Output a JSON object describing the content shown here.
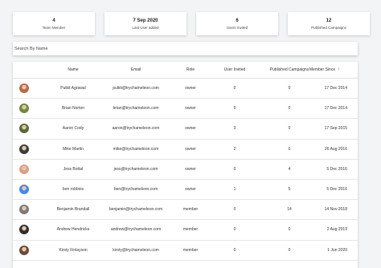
{
  "stats": [
    {
      "value": "4",
      "label": "Team Member"
    },
    {
      "value": "7 Sep 2020",
      "label": "Last User added"
    },
    {
      "value": "6",
      "label": "Users Invited"
    },
    {
      "value": "12",
      "label": "Published Campaigns"
    }
  ],
  "search": {
    "placeholder": "Search By Name"
  },
  "table": {
    "headers": {
      "name": "Name",
      "email": "Email",
      "role": "Role",
      "invited": "User Invited",
      "published": "Published Campaigns",
      "since": "Member Since"
    },
    "sort_icon": "arrow-up",
    "rows": [
      {
        "name": "Pulkit Agrawal",
        "email": "pulkit@trychameleon.com",
        "role": "owner",
        "invited": "0",
        "published": "0",
        "since": "17 Dec 2014",
        "avatar_color": "#b86a4a"
      },
      {
        "name": "Brian Norton",
        "email": "brian@trychameleon.com",
        "role": "owner",
        "invited": "0",
        "published": "0",
        "since": "17 Dec 2014",
        "avatar_color": "#6e8b3d"
      },
      {
        "name": "Aaron Cody",
        "email": "aaron@trychameleon.com",
        "role": "owner",
        "invited": "3",
        "published": "0",
        "since": "17 Sep 2015",
        "avatar_color": "#5a6b3a"
      },
      {
        "name": "Mike Martin",
        "email": "mike@trychameleon.com",
        "role": "owner",
        "invited": "2",
        "published": "0",
        "since": "26 Aug 2016",
        "avatar_color": "#3d3d3d"
      },
      {
        "name": "Jess Bottal",
        "email": "jess@trychameleon.com",
        "role": "owner",
        "invited": "0",
        "published": "4",
        "since": "5 Dec 2016",
        "avatar_color": "#d9a08a"
      },
      {
        "name": "ben robbins",
        "email": "ben@trychameleon.com",
        "role": "owner",
        "invited": "1",
        "published": "5",
        "since": "5 Dec 2016",
        "avatar_color": "#4a86e8"
      },
      {
        "name": "Benjamin Brandall",
        "email": "benjamin@trychameleon.com",
        "role": "member",
        "invited": "0",
        "published": "14",
        "since": "14 Nov 2018",
        "avatar_color": "#7a7a7a"
      },
      {
        "name": "Andrew Hendricks",
        "email": "andrew@trychameleon.com",
        "role": "member",
        "invited": "0",
        "published": "0",
        "since": "2 Aug 2019",
        "avatar_color": "#2f2f2f"
      },
      {
        "name": "Kirsty Finlayson",
        "email": "kirsty@trychameleon.com",
        "role": "member",
        "invited": "0",
        "published": "0",
        "since": "1 Jun 2020",
        "avatar_color": "#6b4a3a"
      }
    ]
  }
}
